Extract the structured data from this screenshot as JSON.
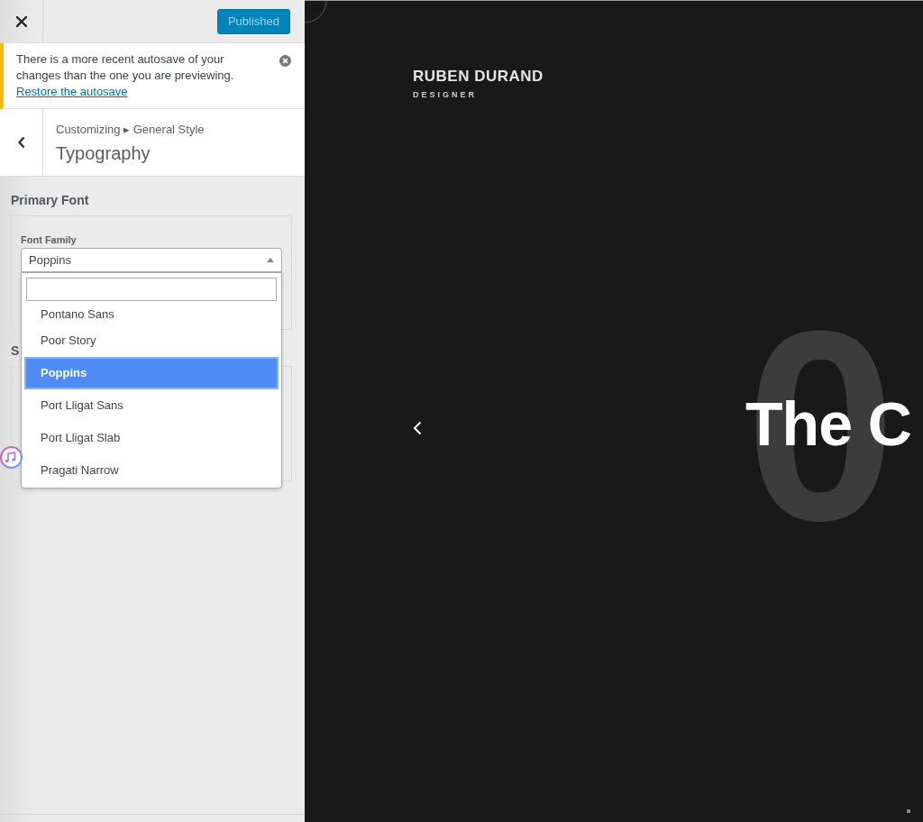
{
  "header": {
    "publish_button": {
      "label": "Published",
      "disabled": true
    }
  },
  "notice": {
    "message": "There is a more recent autosave of your changes than the one you are previewing.",
    "link": "Restore the autosave"
  },
  "section": {
    "breadcrumb": "Customizing ▸ General Style",
    "title": "Typography"
  },
  "primary_font": {
    "heading": "Primary Font",
    "field_label": "Font Family",
    "value": "Poppins",
    "expanded": true,
    "options": [
      {
        "label": "Pontano Sans",
        "selected": false
      },
      {
        "label": "Poor Story",
        "selected": false
      },
      {
        "label": "Poppins",
        "selected": true
      },
      {
        "label": "Port Lligat Sans",
        "selected": false
      },
      {
        "label": "Port Lligat Slab",
        "selected": false
      },
      {
        "label": "Pragati Narrow",
        "selected": false
      }
    ]
  },
  "second_section": {
    "heading": "S"
  },
  "preview": {
    "site_title": "RUBEN DURAND",
    "tagline": "DESIGNER",
    "slide_number": "0",
    "slide_title": "The C"
  }
}
